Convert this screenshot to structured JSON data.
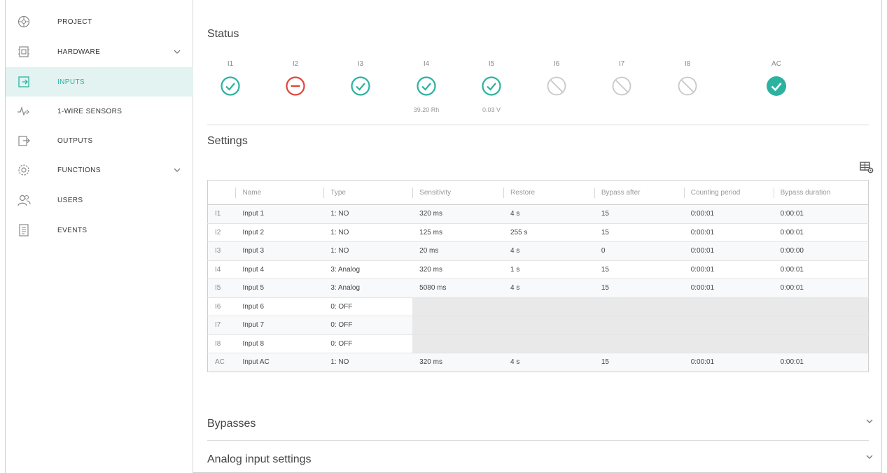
{
  "sidebar": {
    "items": [
      {
        "label": "PROJECT",
        "icon": "project-icon",
        "chevron": false,
        "active": false
      },
      {
        "label": "HARDWARE",
        "icon": "hardware-icon",
        "chevron": true,
        "active": false
      },
      {
        "label": "INPUTS",
        "icon": "inputs-icon",
        "chevron": false,
        "active": true
      },
      {
        "label": "1-WIRE SENSORS",
        "icon": "sensor-icon",
        "chevron": false,
        "active": false
      },
      {
        "label": "OUTPUTS",
        "icon": "outputs-icon",
        "chevron": false,
        "active": false
      },
      {
        "label": "FUNCTIONS",
        "icon": "gear-icon",
        "chevron": true,
        "active": false
      },
      {
        "label": "USERS",
        "icon": "users-icon",
        "chevron": false,
        "active": false
      },
      {
        "label": "EVENTS",
        "icon": "events-icon",
        "chevron": false,
        "active": false
      }
    ]
  },
  "status": {
    "title": "Status",
    "items": [
      {
        "label": "I1",
        "state": "ok",
        "value": ""
      },
      {
        "label": "I2",
        "state": "alarm",
        "value": ""
      },
      {
        "label": "I3",
        "state": "ok",
        "value": ""
      },
      {
        "label": "I4",
        "state": "ok",
        "value": "39.20 Rh"
      },
      {
        "label": "I5",
        "state": "ok",
        "value": "0.03 V"
      },
      {
        "label": "I6",
        "state": "disabled",
        "value": ""
      },
      {
        "label": "I7",
        "state": "disabled",
        "value": ""
      },
      {
        "label": "I8",
        "state": "disabled",
        "value": ""
      },
      {
        "label": "AC",
        "state": "ok-filled",
        "value": ""
      }
    ]
  },
  "settings": {
    "title": "Settings",
    "columns": [
      "",
      "Name",
      "Type",
      "Sensitivity",
      "Restore",
      "Bypass after",
      "Counting period",
      "Bypass duration"
    ],
    "rows": [
      {
        "id": "I1",
        "name": "Input 1",
        "type": "1: NO",
        "sensitivity": "320 ms",
        "restore": "4 s",
        "bypass_after": "15",
        "counting_period": "0:00:01",
        "bypass_duration": "0:00:01",
        "off": false
      },
      {
        "id": "I2",
        "name": "Input 2",
        "type": "1: NO",
        "sensitivity": "125 ms",
        "restore": "255 s",
        "bypass_after": "15",
        "counting_period": "0:00:01",
        "bypass_duration": "0:00:01",
        "off": false
      },
      {
        "id": "I3",
        "name": "Input 3",
        "type": "1: NO",
        "sensitivity": "20 ms",
        "restore": "4 s",
        "bypass_after": "0",
        "counting_period": "0:00:01",
        "bypass_duration": "0:00:00",
        "off": false
      },
      {
        "id": "I4",
        "name": "Input 4",
        "type": "3: Analog",
        "sensitivity": "320 ms",
        "restore": "1 s",
        "bypass_after": "15",
        "counting_period": "0:00:01",
        "bypass_duration": "0:00:01",
        "off": false
      },
      {
        "id": "I5",
        "name": "Input 5",
        "type": "3: Analog",
        "sensitivity": "5080 ms",
        "restore": "4 s",
        "bypass_after": "15",
        "counting_period": "0:00:01",
        "bypass_duration": "0:00:01",
        "off": false
      },
      {
        "id": "I6",
        "name": "Input 6",
        "type": "0: OFF",
        "sensitivity": "",
        "restore": "",
        "bypass_after": "",
        "counting_period": "",
        "bypass_duration": "",
        "off": true
      },
      {
        "id": "I7",
        "name": "Input 7",
        "type": "0: OFF",
        "sensitivity": "",
        "restore": "",
        "bypass_after": "",
        "counting_period": "",
        "bypass_duration": "",
        "off": true
      },
      {
        "id": "I8",
        "name": "Input 8",
        "type": "0: OFF",
        "sensitivity": "",
        "restore": "",
        "bypass_after": "",
        "counting_period": "",
        "bypass_duration": "",
        "off": true
      },
      {
        "id": "AC",
        "name": "Input AC",
        "type": "1: NO",
        "sensitivity": "320 ms",
        "restore": "4 s",
        "bypass_after": "15",
        "counting_period": "0:00:01",
        "bypass_duration": "0:00:01",
        "off": false
      }
    ]
  },
  "sections": {
    "bypasses": "Bypasses",
    "analog": "Analog input settings"
  },
  "colors": {
    "accent": "#2bb3a0",
    "alarm": "#e0463c",
    "disabled": "#c8c8c8",
    "active_bg": "#e3f3f1"
  }
}
